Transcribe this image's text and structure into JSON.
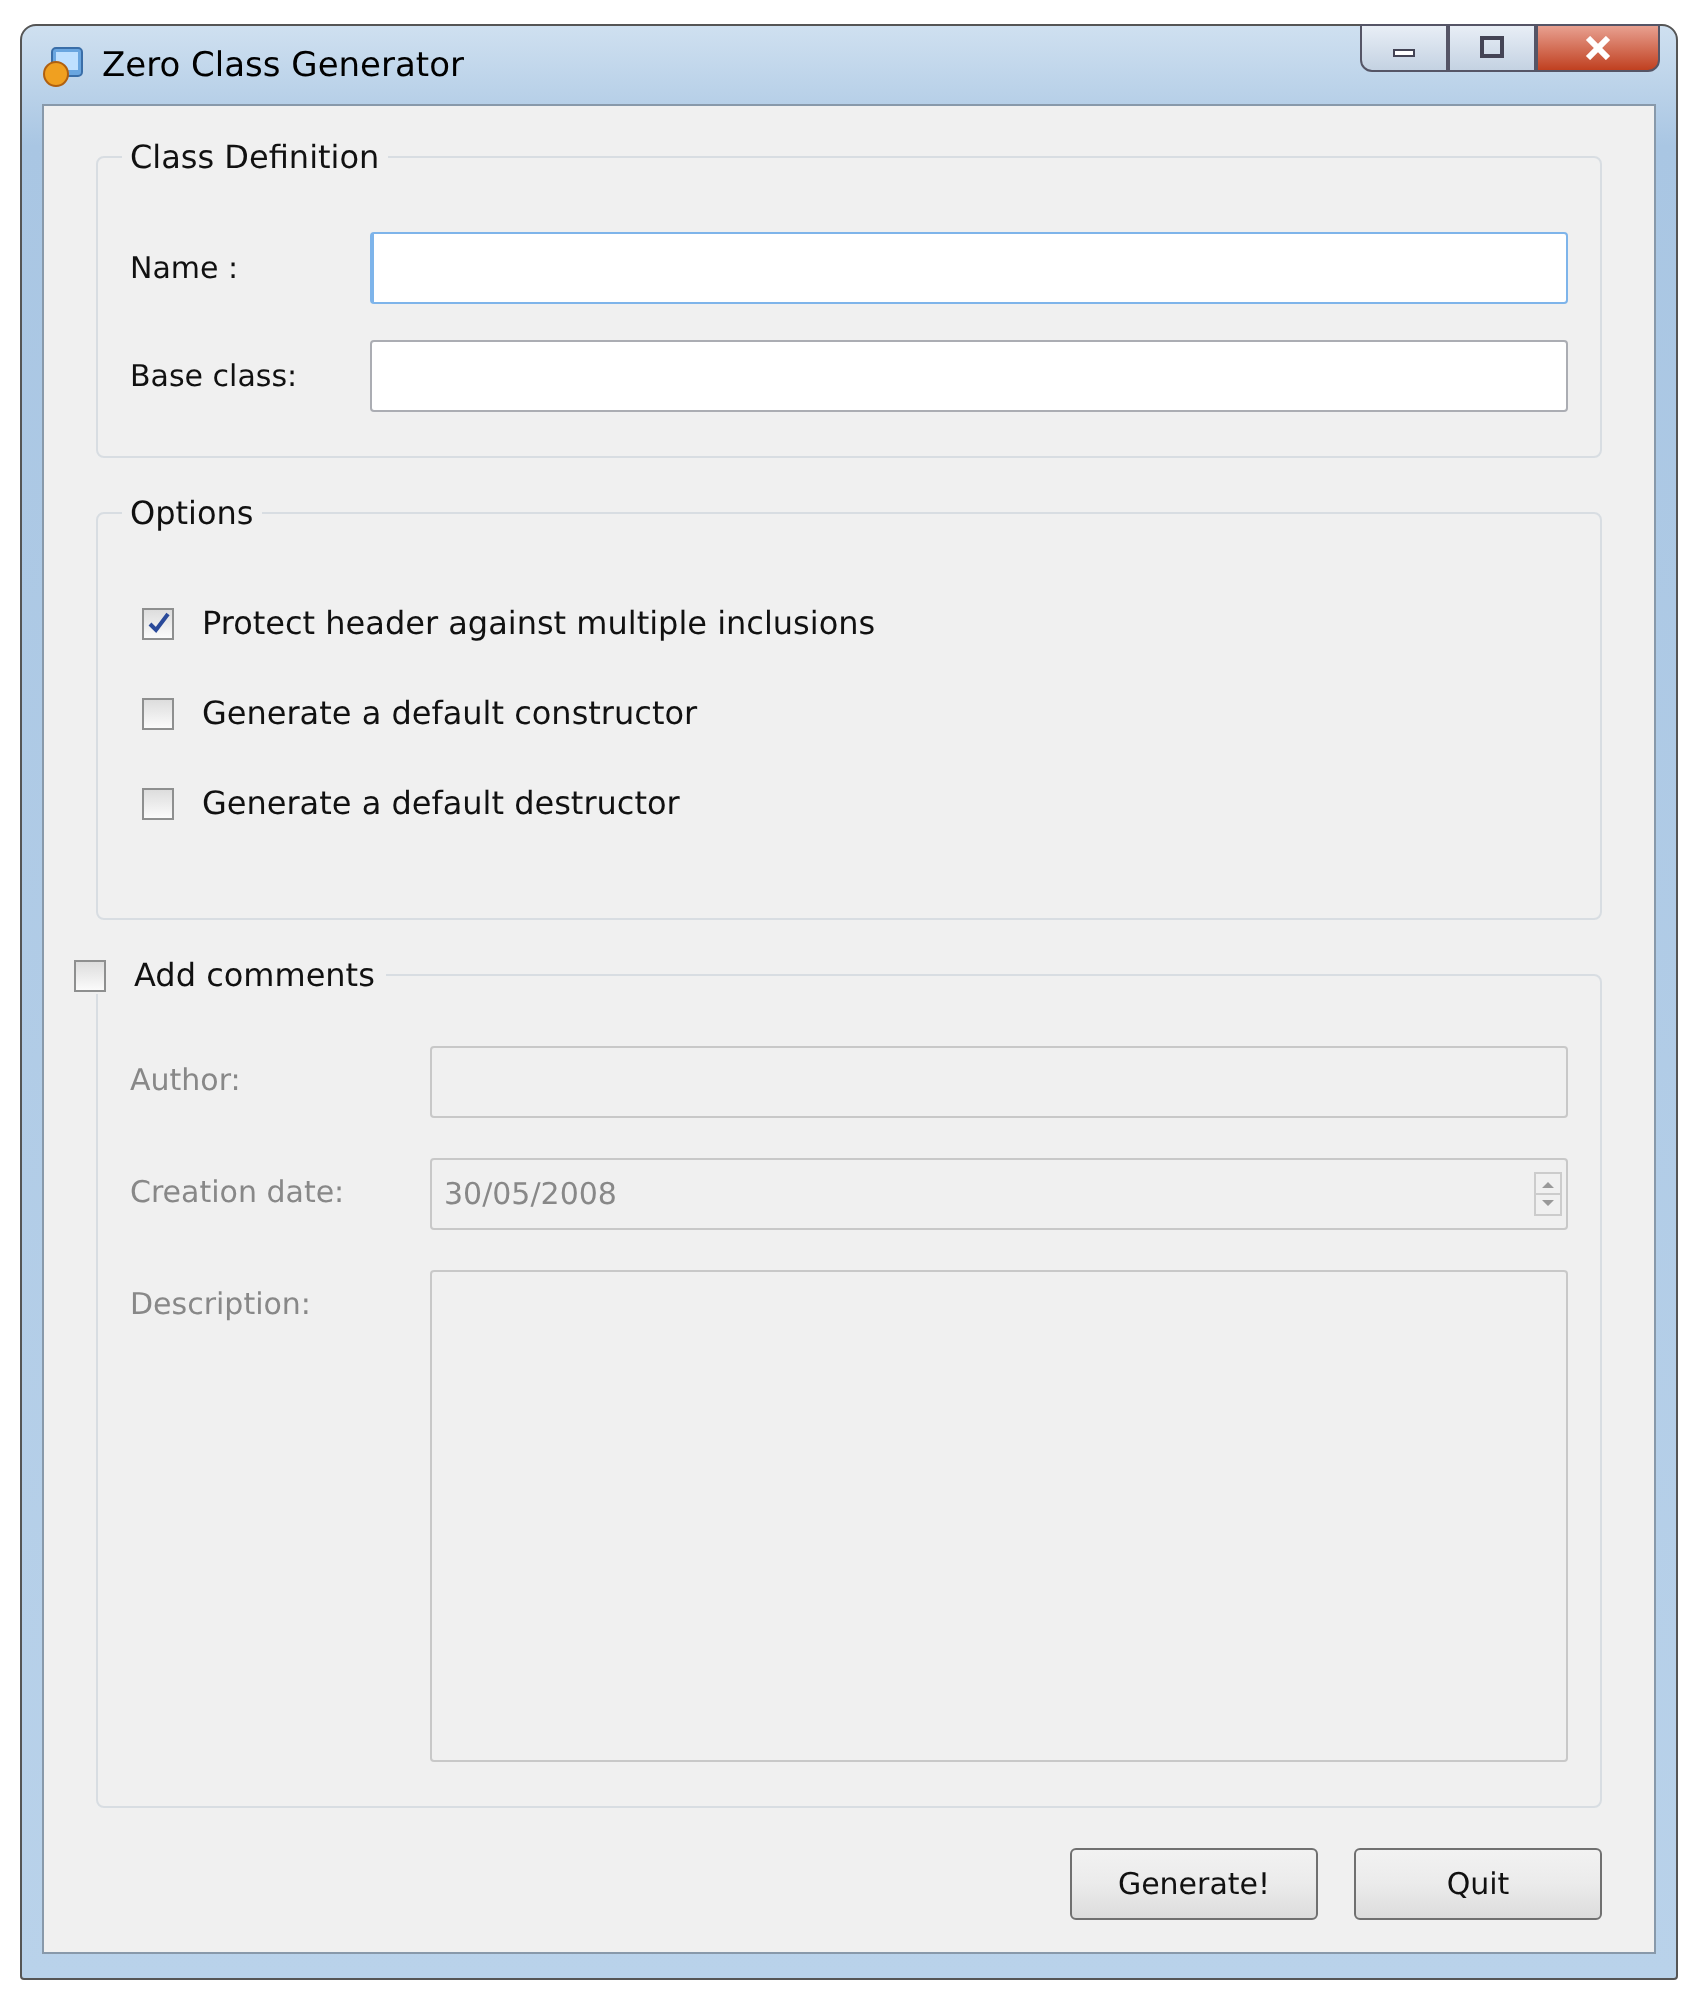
{
  "window": {
    "title": "Zero Class Generator"
  },
  "class_definition": {
    "title": "Class Definition",
    "fields": [
      {
        "label": "Name :",
        "focused": true
      },
      {
        "label": "Base class:",
        "focused": false
      }
    ]
  },
  "options": {
    "title": "Options",
    "items": [
      {
        "label": "Protect header against multiple inclusions",
        "checked": true
      },
      {
        "label": "Generate a default constructor",
        "checked": false
      },
      {
        "label": "Generate a default destructor",
        "checked": false
      }
    ]
  },
  "comments": {
    "label": "Add comments",
    "checked": false,
    "fields": [
      {
        "kind": "text",
        "label": "Author:"
      },
      {
        "kind": "spin",
        "label": "Creation date:",
        "value": "30/05/2008"
      },
      {
        "kind": "area",
        "label": "Description:"
      }
    ]
  },
  "buttons": [
    "Generate!",
    "Quit"
  ]
}
